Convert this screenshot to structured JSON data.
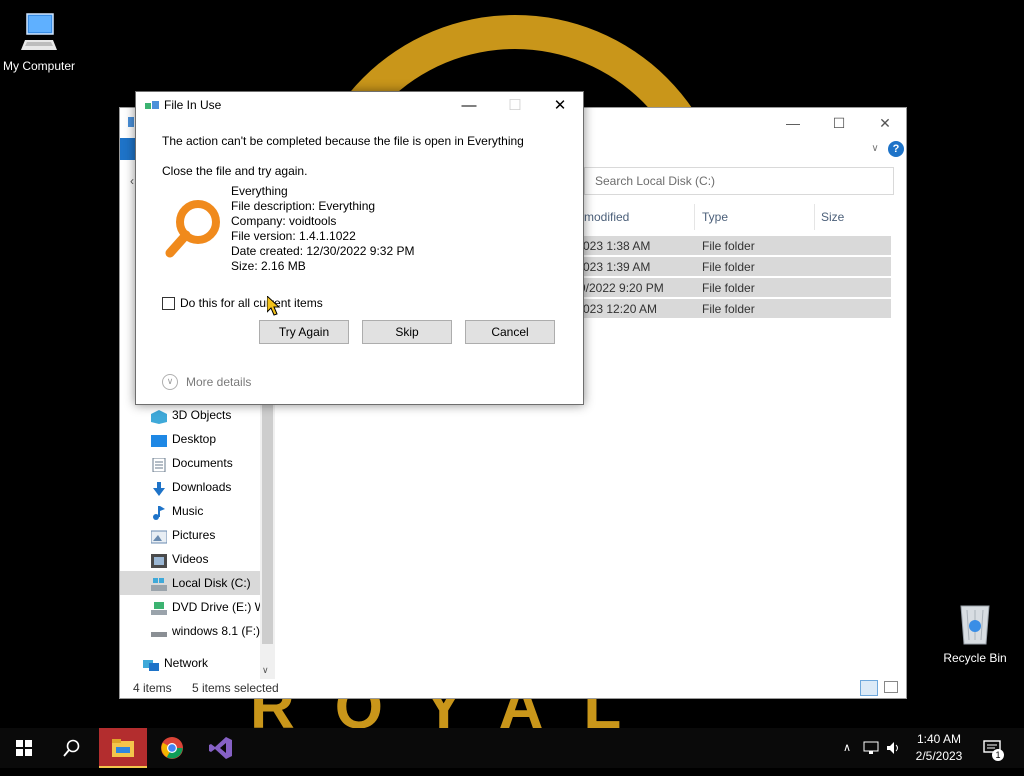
{
  "desktop": {
    "my_computer_label": "My Computer",
    "recycle_bin_label": "Recycle Bin"
  },
  "explorer": {
    "search_placeholder": "Search Local Disk (C:)",
    "columns": {
      "modified": "modified",
      "type": "Type",
      "size": "Size"
    },
    "rows": [
      {
        "modified": "023 1:38 AM",
        "type": "File folder"
      },
      {
        "modified": "023 1:39 AM",
        "type": "File folder"
      },
      {
        "modified": "9/2022 9:20 PM",
        "type": "File folder"
      },
      {
        "modified": "023 12:20 AM",
        "type": "File folder"
      }
    ],
    "nav_items": [
      {
        "label": "3D Objects",
        "icon": "3d-objects-icon"
      },
      {
        "label": "Desktop",
        "icon": "desktop-folder-icon"
      },
      {
        "label": "Documents",
        "icon": "documents-icon"
      },
      {
        "label": "Downloads",
        "icon": "downloads-icon"
      },
      {
        "label": "Music",
        "icon": "music-icon"
      },
      {
        "label": "Pictures",
        "icon": "pictures-icon"
      },
      {
        "label": "Videos",
        "icon": "videos-icon"
      },
      {
        "label": "Local Disk (C:)",
        "icon": "drive-icon",
        "selected": true
      },
      {
        "label": "DVD Drive (E:) W",
        "icon": "dvd-drive-icon"
      },
      {
        "label": "windows 8.1 (F:)",
        "icon": "removable-drive-icon"
      }
    ],
    "network_label": "Network",
    "status_items": "4 items",
    "status_selected": "5 items selected"
  },
  "dialog": {
    "title": "File In Use",
    "message": "The action can't be completed because the file is open in Everything",
    "hint": "Close the file and try again.",
    "file_info": {
      "name": "Everything",
      "description": "File description: Everything",
      "company": "Company: voidtools",
      "version": "File version: 1.4.1.1022",
      "date_created": "Date created: 12/30/2022 9:32 PM",
      "size": "Size: 2.16 MB"
    },
    "checkbox_label": "Do this for all current items",
    "buttons": {
      "try_again": "Try Again",
      "skip": "Skip",
      "cancel": "Cancel"
    },
    "more_details": "More details"
  },
  "taskbar": {
    "time": "1:40 AM",
    "date": "2/5/2023",
    "notification_count": "1"
  },
  "colors": {
    "wallpaper_gold": "#c9961a",
    "everything_orange": "#f08a1c",
    "selection_gray": "#d9d9d9",
    "help_blue": "#1e73c8",
    "taskbar_bg": "#0a0a0a"
  }
}
